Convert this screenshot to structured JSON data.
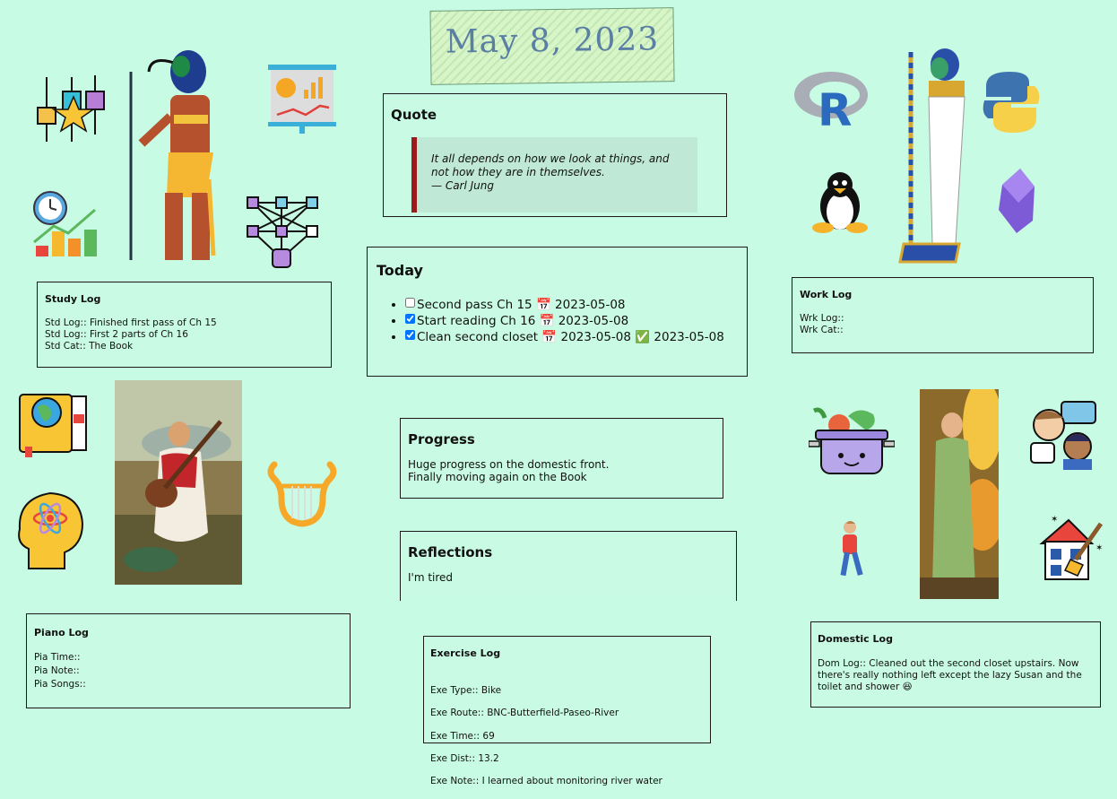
{
  "page": {
    "title": "May 8, 2023"
  },
  "quote": {
    "heading": "Quote",
    "text": "It all depends on how we look at things, and not how they are in themselves.",
    "author": "— Carl Jung"
  },
  "today": {
    "heading": "Today",
    "tasks": [
      {
        "text": "Second pass Ch 15",
        "date": "2023-05-08",
        "checked": false,
        "done_date": ""
      },
      {
        "text": "Start reading Ch 16",
        "date": "2023-05-08",
        "checked": true,
        "done_date": ""
      },
      {
        "text": "Clean second closet",
        "date": "2023-05-08",
        "checked": true,
        "done_date": "2023-05-08"
      }
    ]
  },
  "progress": {
    "heading": "Progress",
    "lines": [
      "Huge progress on the domestic front.",
      "Finally moving again on the Book"
    ]
  },
  "reflections": {
    "heading": "Reflections",
    "text": "I'm tired"
  },
  "study_log": {
    "heading": "Study Log",
    "lines": [
      "Std Log:: Finished first pass of Ch 15",
      "Std Log:: First 2 parts of Ch 16",
      "Std Cat:: The Book"
    ]
  },
  "work_log": {
    "heading": "Work Log",
    "lines": [
      "Wrk Log::",
      "Wrk Cat::"
    ]
  },
  "piano_log": {
    "heading": "Piano Log",
    "lines": [
      "Pia Time::",
      "Pia Note::",
      "Pia Songs::"
    ]
  },
  "exercise_log": {
    "heading": "Exercise Log",
    "lines": [
      "Exe Type:: Bike",
      "Exe Route:: BNC-Butterfield-Paseo-River",
      "Exe Time:: 69",
      "Exe Dist:: 13.2",
      "Exe Note:: I learned about monitoring river water"
    ]
  },
  "domestic_log": {
    "heading": "Domestic Log",
    "text": "Dom Log:: Cleaned out the second closet upstairs. Now there's really nothing left except the lazy Susan and the toilet and shower 😆"
  },
  "icons": {
    "left": [
      "boxplot-star-icon",
      "thoth-figure",
      "presentation-chart-icon",
      "clock-growth-chart-icon",
      "network-graph-icon",
      "globe-book-icon",
      "saraswati-painting",
      "lyre-icon",
      "science-head-icon"
    ],
    "right": [
      "r-logo-icon",
      "egyptian-god-figure",
      "python-logo-icon",
      "linux-penguin-icon",
      "obsidian-gem-icon",
      "cooking-pot-icon",
      "goddess-painting",
      "conversation-people-icon",
      "walking-child-icon",
      "house-cleaning-icon"
    ]
  },
  "colors": {
    "background": "#c8fbe4",
    "quote_bar": "#9b1b1b",
    "title": "#5b7fa3"
  }
}
